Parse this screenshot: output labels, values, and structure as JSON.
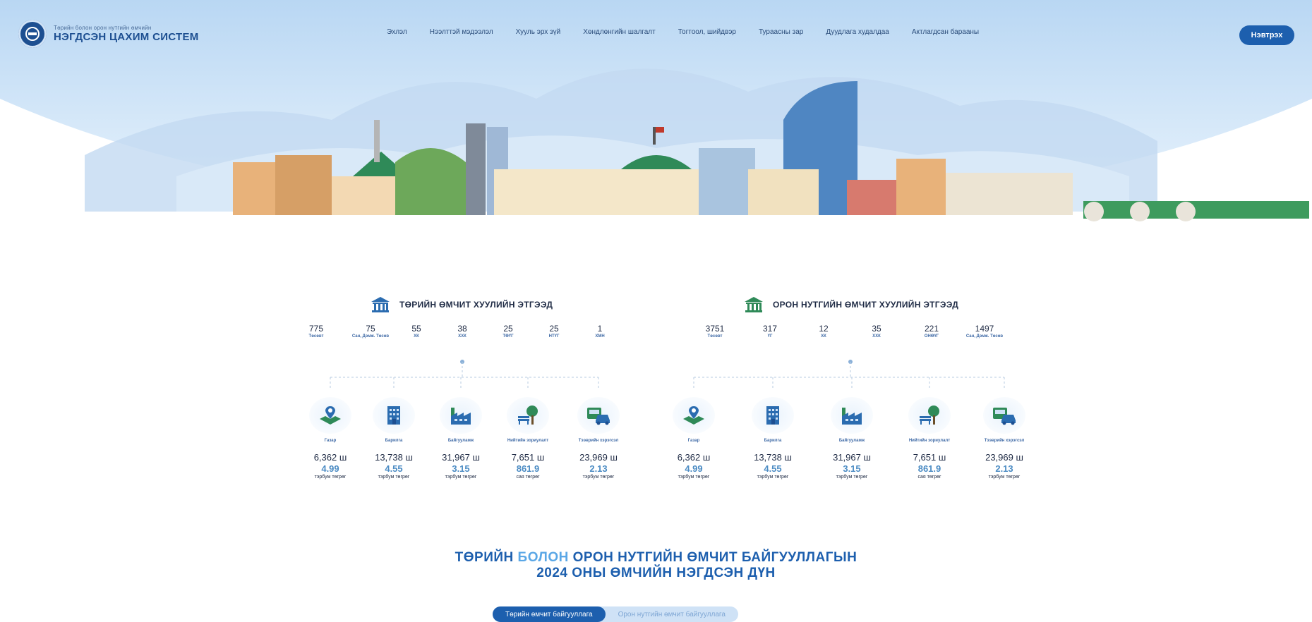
{
  "header": {
    "logo_subtitle": "Төрийн болон орон нутгийн өмчийн",
    "logo_title": "НЭГДСЭН ЦАХИМ СИСТЕМ",
    "nav": [
      "Эхлэл",
      "Нээлттэй мэдээлэл",
      "Хууль эрх зүй",
      "Хөндлөнгийн шалгалт",
      "Тогтоол, шийдвэр",
      "Тураасны зар",
      "Дуудлага худалдаа",
      "Актлагдсан барааны"
    ],
    "login_label": "Нэвтрэх"
  },
  "state": {
    "title": "ТӨРИЙН ӨМЧИТ ХУУЛИЙН ЭТГЭЭД",
    "counts": [
      {
        "value": "775",
        "label": "Төсөвт"
      },
      {
        "value": "75",
        "label": "Сан, Дэмж. Төсөв"
      },
      {
        "value": "55",
        "label": "ХК"
      },
      {
        "value": "38",
        "label": "ХХК"
      },
      {
        "value": "25",
        "label": "ТӨҮГ"
      },
      {
        "value": "25",
        "label": "НТҮГ"
      },
      {
        "value": "1",
        "label": "ХМН"
      }
    ],
    "cards": [
      {
        "name": "Газар",
        "qty": "6,362 ш",
        "value": "4.99",
        "unit": "тэрбум төгрөг"
      },
      {
        "name": "Барилга",
        "qty": "13,738 ш",
        "value": "4.55",
        "unit": "тэрбум төгрөг"
      },
      {
        "name": "Байгууламж",
        "qty": "31,967 ш",
        "value": "3.15",
        "unit": "тэрбум төгрөг"
      },
      {
        "name": "Нийтийн зориулалт",
        "qty": "7,651 ш",
        "value": "861.9",
        "unit": "сая төгрөг"
      },
      {
        "name": "Тээврийн хэрэгсэл",
        "qty": "23,969 ш",
        "value": "2.13",
        "unit": "тэрбум төгрөг"
      }
    ]
  },
  "local": {
    "title": "ОРОН НУТГИЙН ӨМЧИТ ХУУЛИЙН ЭТГЭЭД",
    "counts": [
      {
        "value": "3751",
        "label": "Төсөвт"
      },
      {
        "value": "317",
        "label": "ҮГ"
      },
      {
        "value": "12",
        "label": "ХК"
      },
      {
        "value": "35",
        "label": "ХХК"
      },
      {
        "value": "221",
        "label": "ОНӨҮГ"
      },
      {
        "value": "1497",
        "label": "Сан, Дэмж. Төсөв"
      }
    ],
    "cards": [
      {
        "name": "Газар",
        "qty": "6,362 ш",
        "value": "4.99",
        "unit": "тэрбум төгрөг"
      },
      {
        "name": "Барилга",
        "qty": "13,738 ш",
        "value": "4.55",
        "unit": "тэрбум төгрөг"
      },
      {
        "name": "Байгууламж",
        "qty": "31,967 ш",
        "value": "3.15",
        "unit": "тэрбум төгрөг"
      },
      {
        "name": "Нийтийн зориулалт",
        "qty": "7,651 ш",
        "value": "861.9",
        "unit": "сая төгрөг"
      },
      {
        "name": "Тээврийн хэрэгсэл",
        "qty": "23,969 ш",
        "value": "2.13",
        "unit": "тэрбум төгрөг"
      }
    ]
  },
  "summary": {
    "line1_a": "ТӨРИЙН ",
    "line1_b": "БОЛОН",
    "line1_c": " ОРОН НУТГИЙН ӨМЧИТ БАЙГУУЛЛАГЫН",
    "line2": "2024 ОНЫ ӨМЧИЙН НЭГДСЭН ДҮН",
    "tabs": [
      "Төрийн өмчит байгууллага",
      "Орон нутгийн өмчит байгууллага"
    ]
  },
  "icons": [
    "land-icon",
    "building-icon",
    "factory-icon",
    "public-park-icon",
    "vehicle-icon",
    "institution-icon"
  ],
  "colors": {
    "primary": "#1d5fae",
    "accent": "#4c8cc4",
    "sky": "#cfe2f6"
  }
}
